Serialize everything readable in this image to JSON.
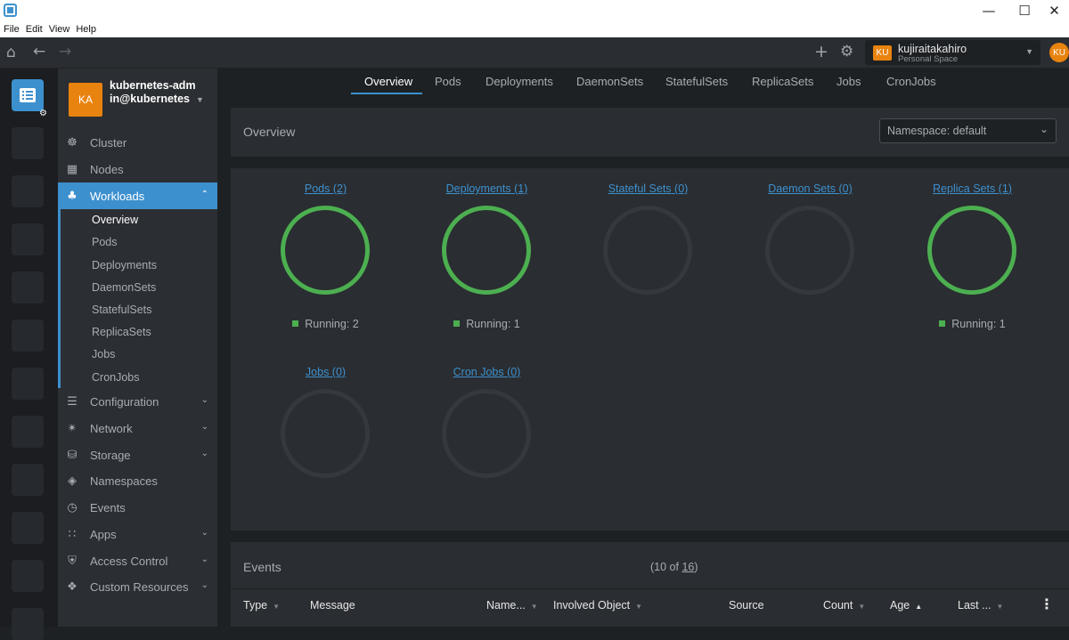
{
  "menu": [
    "File",
    "Edit",
    "View",
    "Help"
  ],
  "workspace": {
    "badge": "KU",
    "name": "kujiraitakahiro",
    "sub": "Personal Space"
  },
  "user_avatar": "KU",
  "cluster": {
    "badge": "KA",
    "name": "kubernetes-admin@kubernetes"
  },
  "sidebar": {
    "items": [
      {
        "label": "Cluster",
        "icon": "helm-icon"
      },
      {
        "label": "Nodes",
        "icon": "nodes-icon"
      },
      {
        "label": "Workloads",
        "icon": "workloads-icon"
      },
      {
        "label": "Configuration",
        "icon": "list-icon"
      },
      {
        "label": "Network",
        "icon": "network-icon"
      },
      {
        "label": "Storage",
        "icon": "database-icon"
      },
      {
        "label": "Namespaces",
        "icon": "layers-icon"
      },
      {
        "label": "Events",
        "icon": "clock-icon"
      },
      {
        "label": "Apps",
        "icon": "grid-icon"
      },
      {
        "label": "Access Control",
        "icon": "shield-icon"
      },
      {
        "label": "Custom Resources",
        "icon": "puzzle-icon"
      }
    ],
    "workload_sub": [
      "Overview",
      "Pods",
      "Deployments",
      "DaemonSets",
      "StatefulSets",
      "ReplicaSets",
      "Jobs",
      "CronJobs"
    ]
  },
  "tabs": [
    "Overview",
    "Pods",
    "Deployments",
    "DaemonSets",
    "StatefulSets",
    "ReplicaSets",
    "Jobs",
    "CronJobs"
  ],
  "overview": {
    "title": "Overview",
    "namespace": "Namespace: default",
    "workloads": [
      {
        "link": "Pods (2)",
        "status": "Running: 2",
        "ok": true
      },
      {
        "link": "Deployments (1)",
        "status": "Running: 1",
        "ok": true
      },
      {
        "link": "Stateful Sets (0)",
        "status": "",
        "ok": false
      },
      {
        "link": "Daemon Sets (0)",
        "status": "",
        "ok": false
      },
      {
        "link": "Replica Sets (1)",
        "status": "Running: 1",
        "ok": true
      },
      {
        "link": "Jobs (0)",
        "status": "",
        "ok": false
      },
      {
        "link": "Cron Jobs (0)",
        "status": "",
        "ok": false
      }
    ]
  },
  "events": {
    "title": "Events",
    "count_prefix": "(10 of ",
    "count_total": "16",
    "count_suffix": ")",
    "columns": [
      "Type",
      "Message",
      "Name...",
      "Involved Object",
      "Source",
      "Count",
      "Age",
      "Last ..."
    ]
  },
  "colors": {
    "accent": "#3d90ce",
    "ok": "#4caf50",
    "badge": "#e8830f"
  }
}
